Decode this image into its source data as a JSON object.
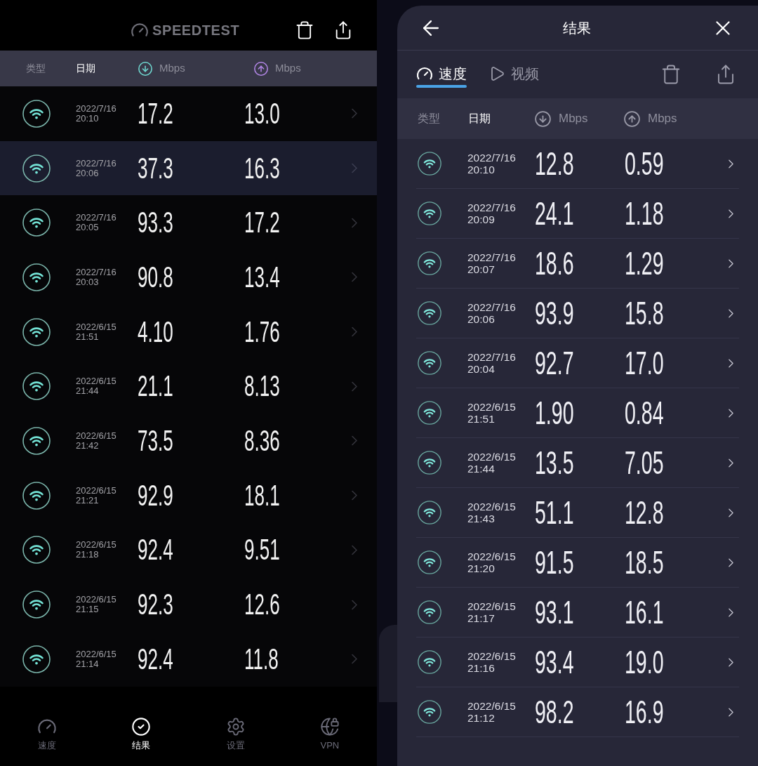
{
  "phone": {
    "logo": "SPEEDTEST",
    "columns": [
      {
        "kind": "type",
        "label": "类型",
        "selected": false
      },
      {
        "kind": "date",
        "label": "日期",
        "selected": true
      },
      {
        "kind": "download",
        "label": "Mbps",
        "selected": false
      },
      {
        "kind": "upload",
        "label": "Mbps",
        "selected": false
      }
    ],
    "rows": [
      {
        "date": "2022/7/16",
        "time": "20:10",
        "download": "17.2",
        "upload": "13.0",
        "selected": false
      },
      {
        "date": "2022/7/16",
        "time": "20:06",
        "download": "37.3",
        "upload": "16.3",
        "selected": true
      },
      {
        "date": "2022/7/16",
        "time": "20:05",
        "download": "93.3",
        "upload": "17.2",
        "selected": false
      },
      {
        "date": "2022/7/16",
        "time": "20:03",
        "download": "90.8",
        "upload": "13.4",
        "selected": false
      },
      {
        "date": "2022/6/15",
        "time": "21:51",
        "download": "4.10",
        "upload": "1.76",
        "selected": false
      },
      {
        "date": "2022/6/15",
        "time": "21:44",
        "download": "21.1",
        "upload": "8.13",
        "selected": false
      },
      {
        "date": "2022/6/15",
        "time": "21:42",
        "download": "73.5",
        "upload": "8.36",
        "selected": false
      },
      {
        "date": "2022/6/15",
        "time": "21:21",
        "download": "92.9",
        "upload": "18.1",
        "selected": false
      },
      {
        "date": "2022/6/15",
        "time": "21:18",
        "download": "92.4",
        "upload": "9.51",
        "selected": false
      },
      {
        "date": "2022/6/15",
        "time": "21:15",
        "download": "92.3",
        "upload": "12.6",
        "selected": false
      },
      {
        "date": "2022/6/15",
        "time": "21:14",
        "download": "92.4",
        "upload": "11.8",
        "selected": false
      }
    ],
    "nav": [
      {
        "kind": "speed",
        "label": "速度",
        "selected": false
      },
      {
        "kind": "results",
        "label": "结果",
        "selected": true
      },
      {
        "kind": "settings",
        "label": "设置",
        "selected": false
      },
      {
        "kind": "vpn",
        "label": "VPN",
        "selected": false
      }
    ]
  },
  "results_panel": {
    "title": "结果",
    "tabs": [
      {
        "kind": "speed",
        "label": "速度",
        "selected": true
      },
      {
        "kind": "video",
        "label": "视频",
        "selected": false
      }
    ],
    "columns": [
      {
        "kind": "type",
        "label": "类型",
        "selected": false
      },
      {
        "kind": "date",
        "label": "日期",
        "selected": true
      },
      {
        "kind": "download",
        "label": "Mbps",
        "selected": false
      },
      {
        "kind": "upload",
        "label": "Mbps",
        "selected": false
      }
    ],
    "rows": [
      {
        "date": "2022/7/16",
        "time": "20:10",
        "download": "12.8",
        "upload": "0.59"
      },
      {
        "date": "2022/7/16",
        "time": "20:09",
        "download": "24.1",
        "upload": "1.18"
      },
      {
        "date": "2022/7/16",
        "time": "20:07",
        "download": "18.6",
        "upload": "1.29"
      },
      {
        "date": "2022/7/16",
        "time": "20:06",
        "download": "93.9",
        "upload": "15.8"
      },
      {
        "date": "2022/7/16",
        "time": "20:04",
        "download": "92.7",
        "upload": "17.0"
      },
      {
        "date": "2022/6/15",
        "time": "21:51",
        "download": "1.90",
        "upload": "0.84"
      },
      {
        "date": "2022/6/15",
        "time": "21:44",
        "download": "13.5",
        "upload": "7.05"
      },
      {
        "date": "2022/6/15",
        "time": "21:43",
        "download": "51.1",
        "upload": "12.8"
      },
      {
        "date": "2022/6/15",
        "time": "21:20",
        "download": "91.5",
        "upload": "18.5"
      },
      {
        "date": "2022/6/15",
        "time": "21:17",
        "download": "93.1",
        "upload": "16.1"
      },
      {
        "date": "2022/6/15",
        "time": "21:16",
        "download": "93.4",
        "upload": "19.0"
      },
      {
        "date": "2022/6/15",
        "time": "21:12",
        "download": "98.2",
        "upload": "16.9"
      }
    ]
  }
}
